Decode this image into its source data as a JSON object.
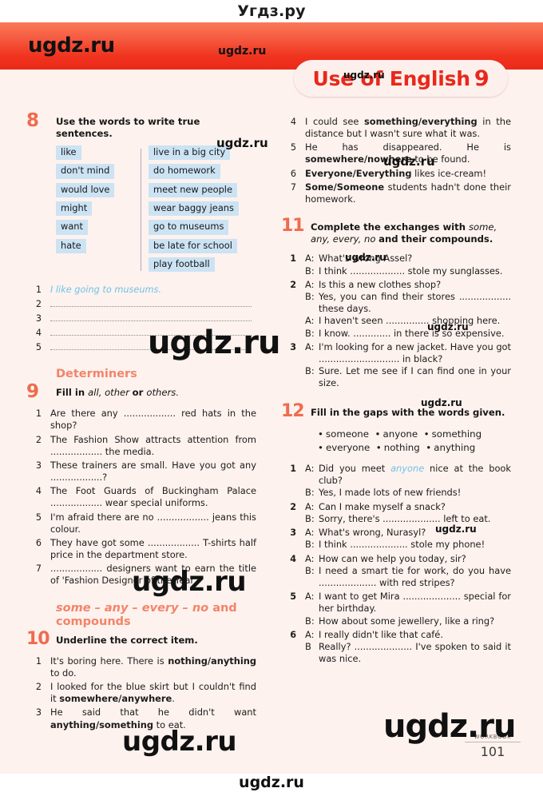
{
  "site": {
    "header_title": "Угдз.ру",
    "bottom_watermark": "ugdz.ru"
  },
  "banner": {
    "logo": "ugdz.ru",
    "watermark": "ugdz.ru",
    "tab_watermark": "ugdz.ru",
    "tab_title": "Use of English",
    "tab_number": "9"
  },
  "footer": {
    "label": "WORKBOOK",
    "page": "101"
  },
  "watermarks": {
    "w1": "ugdz.ru",
    "w2": "ugdz.ru",
    "w3": "ugdz.ru",
    "w4": "ugdz.ru",
    "w5": "ugdz.ru",
    "w6": "ugdz.ru",
    "w7": "ugdz.ru",
    "w8": "ugdz.ru",
    "w9": "ugdz.ru"
  },
  "ex8": {
    "number": "8",
    "instruction": "Use the words to write true sentences.",
    "bank_left": [
      "like",
      "don't mind",
      "would love",
      "might",
      "want",
      "hate"
    ],
    "bank_right": [
      "live in a big city",
      "do homework",
      "meet new people",
      "wear baggy jeans",
      "go to museums",
      "be late for school",
      "play football"
    ],
    "answers": [
      {
        "n": "1",
        "sample": "I like going to museums."
      },
      {
        "n": "2",
        "sample": ""
      },
      {
        "n": "3",
        "sample": ""
      },
      {
        "n": "4",
        "sample": ""
      },
      {
        "n": "5",
        "sample": ""
      }
    ]
  },
  "determiners_heading": "Determiners",
  "ex9": {
    "number": "9",
    "instruction_a": "Fill in ",
    "instruction_b": "all, other ",
    "instruction_c": "or ",
    "instruction_d": "others.",
    "items": [
      {
        "n": "1",
        "text": "Are there any .................. red hats in the shop?"
      },
      {
        "n": "2",
        "text": "The Fashion Show attracts attention from .................. the media."
      },
      {
        "n": "3",
        "text": "These trainers are small. Have you got any ..................?"
      },
      {
        "n": "4",
        "text": "The Foot Guards of Buckingham Palace .................. wear special uniforms."
      },
      {
        "n": "5",
        "text": "I'm afraid there are no .................. jeans this colour."
      },
      {
        "n": "6",
        "text": "They have got some .................. T-shirts half price in the department store."
      },
      {
        "n": "7",
        "text": ".................. designers want to earn the title of 'Fashion Designer of the Year'."
      }
    ]
  },
  "compounds_heading_line1": "some – any – every – no",
  "compounds_heading_and": " and",
  "compounds_heading_line2": "compounds",
  "ex10": {
    "number": "10",
    "instruction": "Underline the correct item.",
    "items": [
      {
        "n": "1",
        "pre": "It's boring here. There is ",
        "bold": "nothing/anything",
        "post": " to do."
      },
      {
        "n": "2",
        "pre": "I looked for the blue skirt but I couldn't find it ",
        "bold": "somewhere/anywhere",
        "post": "."
      },
      {
        "n": "3",
        "pre": "He said that he didn't want ",
        "bold": "anything/something",
        "post": " to eat."
      },
      {
        "n": "4",
        "pre": "I could see ",
        "bold": "something/everything",
        "post": " in the distance but I wasn't sure what it was."
      },
      {
        "n": "5",
        "pre": "He has disappeared. He is ",
        "bold": "somewhere/nowhere",
        "post": " to be found."
      },
      {
        "n": "6",
        "pre": "",
        "bold": "Everyone/Everything",
        "post": " likes ice-cream!"
      },
      {
        "n": "7",
        "pre": "",
        "bold": "Some/Someone",
        "post": " students hadn't done their homework."
      }
    ]
  },
  "ex11": {
    "number": "11",
    "instruction_a": "Complete the exchanges with ",
    "instruction_b": "some, any, every, no ",
    "instruction_c": "and their compounds.",
    "items": [
      {
        "n": "1",
        "lines": [
          {
            "spk": "A:",
            "text": "What's wrong Assel?"
          },
          {
            "spk": "B:",
            "text": "I think ................... stole my sunglasses."
          }
        ]
      },
      {
        "n": "2",
        "lines": [
          {
            "spk": "A:",
            "text": "Is this a new clothes shop?"
          },
          {
            "spk": "B:",
            "text": "Yes, you can find their stores .................. these days."
          },
          {
            "spk": "A:",
            "text": "I haven't seen ............... shopping here."
          },
          {
            "spk": "B:",
            "text": "I know. ............. in there is so expensive."
          }
        ]
      },
      {
        "n": "3",
        "lines": [
          {
            "spk": "A:",
            "text": "I'm looking for a new jacket. Have you got ............................ in black?"
          },
          {
            "spk": "B:",
            "text": "Sure. Let me see if I can find one in your size."
          }
        ]
      }
    ]
  },
  "ex12": {
    "number": "12",
    "instruction": "Fill in the gaps with the words given.",
    "bank_row1": [
      "someone",
      "anyone",
      "something"
    ],
    "bank_row2": [
      "everyone",
      "nothing",
      "anything"
    ],
    "items": [
      {
        "n": "1",
        "lines": [
          {
            "spk": "A:",
            "pre": "Did you meet ",
            "sample": "anyone",
            "post": " nice at the book club?"
          },
          {
            "spk": "B:",
            "pre": "Yes, I made lots of new friends!",
            "sample": "",
            "post": ""
          }
        ]
      },
      {
        "n": "2",
        "lines": [
          {
            "spk": "A:",
            "pre": "Can I make myself a snack?",
            "sample": "",
            "post": ""
          },
          {
            "spk": "B:",
            "pre": "Sorry, there's .................... left to eat.",
            "sample": "",
            "post": ""
          }
        ]
      },
      {
        "n": "3",
        "lines": [
          {
            "spk": "A:",
            "pre": "What's wrong, Nurasyl?",
            "sample": "",
            "post": ""
          },
          {
            "spk": "B:",
            "pre": "I think .................... stole my phone!",
            "sample": "",
            "post": ""
          }
        ]
      },
      {
        "n": "4",
        "lines": [
          {
            "spk": "A:",
            "pre": "How can we help you today, sir?",
            "sample": "",
            "post": ""
          },
          {
            "spk": "B:",
            "pre": "I need a smart tie for work, do you have .................... with red stripes?",
            "sample": "",
            "post": ""
          }
        ]
      },
      {
        "n": "5",
        "lines": [
          {
            "spk": "A:",
            "pre": "I want to get Mira .................... special for her birthday.",
            "sample": "",
            "post": ""
          },
          {
            "spk": "B:",
            "pre": "How about some jewellery, like a ring?",
            "sample": "",
            "post": ""
          }
        ]
      },
      {
        "n": "6",
        "lines": [
          {
            "spk": "A:",
            "pre": "I really didn't like that café.",
            "sample": "",
            "post": ""
          },
          {
            "spk": "B",
            "pre": "Really? .................... I've spoken to said it was nice.",
            "sample": "",
            "post": ""
          }
        ]
      }
    ]
  },
  "colors": {
    "banner_top": "#f9795a",
    "banner_bottom": "#ea2a18",
    "exercise_number": "#ef6b4d",
    "section_heading": "#f2846a",
    "word_box": "#cce3f3",
    "sample_answer": "#6fc3e8",
    "page_bg": "#fdf2ee",
    "tab_text": "#e8281c"
  }
}
